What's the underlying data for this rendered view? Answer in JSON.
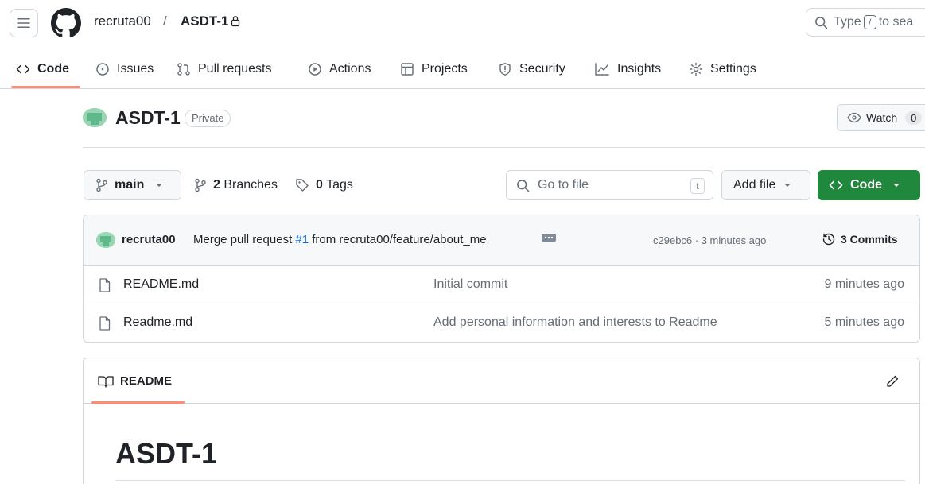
{
  "header": {
    "owner": "recruta00",
    "separator": "/",
    "repo": "ASDT-1",
    "search_prefix": "Type",
    "search_key": "/",
    "search_suffix": "to sea"
  },
  "tabs": [
    {
      "label": "Code"
    },
    {
      "label": "Issues"
    },
    {
      "label": "Pull requests"
    },
    {
      "label": "Actions"
    },
    {
      "label": "Projects"
    },
    {
      "label": "Security"
    },
    {
      "label": "Insights"
    },
    {
      "label": "Settings"
    }
  ],
  "repo_header": {
    "title": "ASDT-1",
    "visibility": "Private",
    "watch_label": "Watch",
    "watch_count": "0"
  },
  "toolbar": {
    "branch": "main",
    "branches_count": "2",
    "branches_label": "Branches",
    "tags_count": "0",
    "tags_label": "Tags",
    "goto_placeholder": "Go to file",
    "goto_key": "t",
    "add_file": "Add file",
    "code_button": "Code"
  },
  "latest_commit": {
    "author": "recruta00",
    "message_prefix": "Merge pull request",
    "pr_link": "#1",
    "message_suffix": "from recruta00/feature/about_me",
    "hash_time": "c29ebc6 · 3 minutes ago",
    "commits_label": "3 Commits"
  },
  "files": [
    {
      "name": "README.md",
      "message": "Initial commit",
      "time": "9 minutes ago"
    },
    {
      "name": "Readme.md",
      "message": "Add personal information and interests to Readme",
      "time": "5 minutes ago"
    }
  ],
  "readme": {
    "tab_label": "README",
    "heading": "ASDT-1"
  },
  "colors": {
    "accent_underline": "#fd8c73",
    "code_button": "#1f883d",
    "link": "#0969da"
  }
}
